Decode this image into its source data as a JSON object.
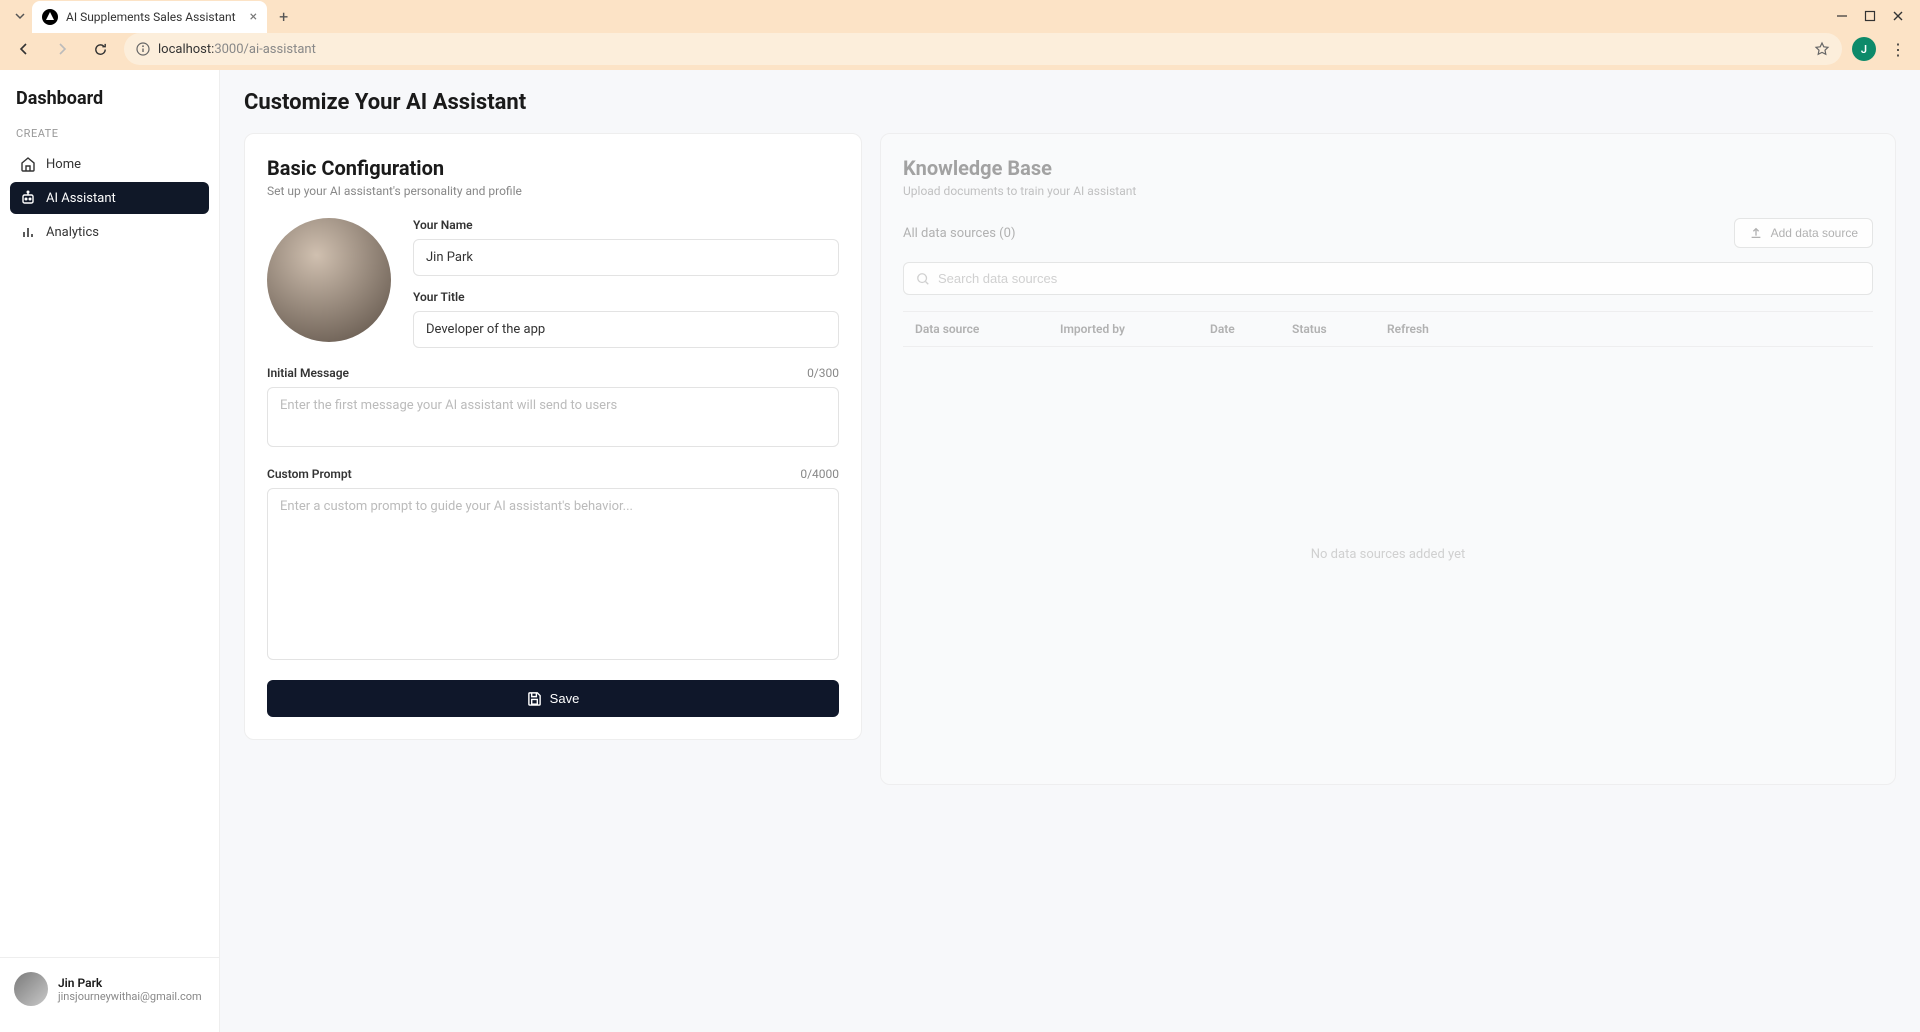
{
  "browser": {
    "tab_title": "AI Supplements Sales Assistant",
    "url_host": "localhost:",
    "url_port_path": "3000/ai-assistant",
    "avatar_initial": "J"
  },
  "sidebar": {
    "title": "Dashboard",
    "section_label": "CREATE",
    "items": [
      {
        "label": "Home"
      },
      {
        "label": "AI Assistant"
      },
      {
        "label": "Analytics"
      }
    ],
    "user": {
      "name": "Jin Park",
      "email": "jinsjourneywithai@gmail.com"
    }
  },
  "page": {
    "title": "Customize Your AI Assistant"
  },
  "basic_config": {
    "heading": "Basic Configuration",
    "subtitle": "Set up your AI assistant's personality and profile",
    "name_label": "Your Name",
    "name_value": "Jin Park",
    "title_label": "Your Title",
    "title_value": "Developer of the app",
    "initial_label": "Initial Message",
    "initial_counter": "0/300",
    "initial_placeholder": "Enter the first message your AI assistant will send to users",
    "prompt_label": "Custom Prompt",
    "prompt_counter": "0/4000",
    "prompt_placeholder": "Enter a custom prompt to guide your AI assistant's behavior...",
    "save_label": "Save"
  },
  "knowledge_base": {
    "heading": "Knowledge Base",
    "subtitle": "Upload documents to train your AI assistant",
    "count_label": "All data sources (0)",
    "add_label": "Add data source",
    "search_placeholder": "Search data sources",
    "columns": {
      "data_source": "Data source",
      "imported_by": "Imported by",
      "date": "Date",
      "status": "Status",
      "refresh": "Refresh"
    },
    "empty": "No data sources added yet"
  }
}
